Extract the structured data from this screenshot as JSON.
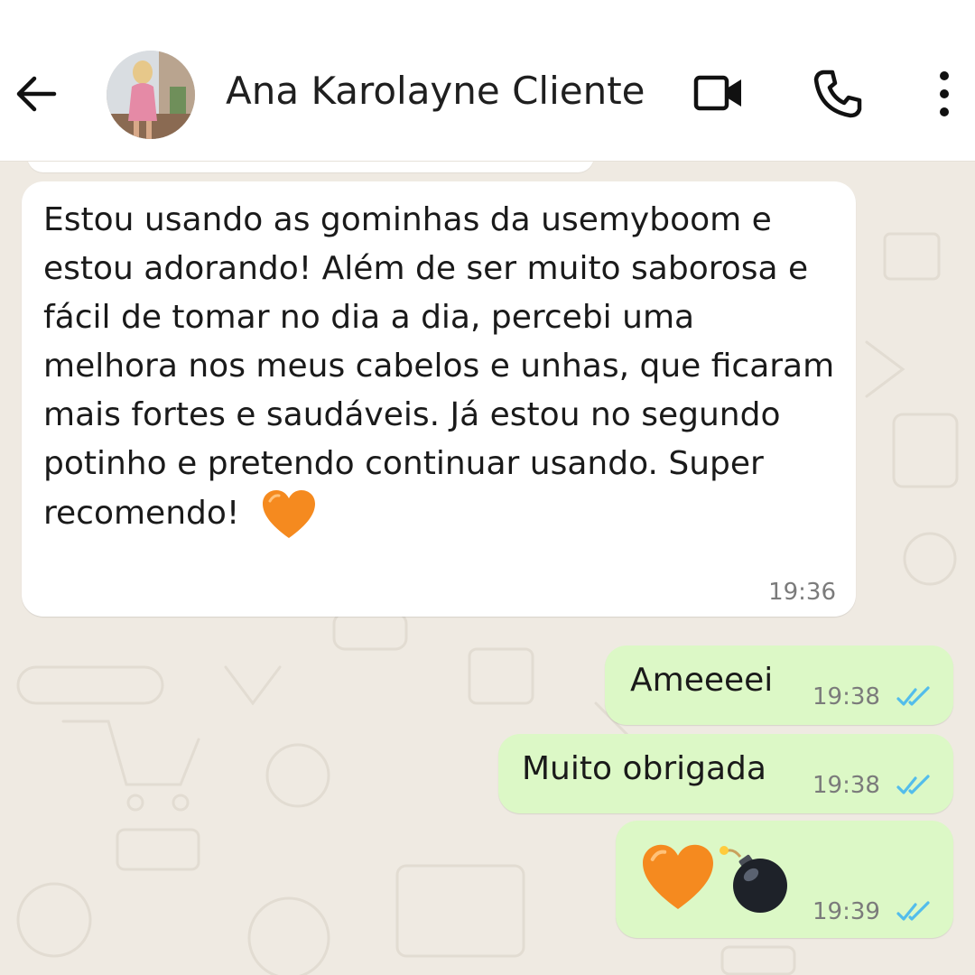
{
  "header": {
    "back_icon": "arrow-left-icon",
    "contact_name": "Ana Karolayne Cliente",
    "icons": [
      "video-call-icon",
      "voice-call-icon",
      "more-options-icon"
    ]
  },
  "messages": [
    {
      "direction": "incoming",
      "text": "Estou usando as gominhas  da usemyboom e estou adorando! Além de ser muito saborosa e fácil de tomar no dia a dia, percebi uma melhora nos meus cabelos e unhas, que ficaram mais fortes e saudáveis. Já estou no segundo potinho e pretendo continuar usando. Super recomendo!",
      "emoji": "orange-heart",
      "time": "19:36"
    },
    {
      "direction": "outgoing",
      "text": "Ameeeei",
      "time": "19:38",
      "status": "read"
    },
    {
      "direction": "outgoing",
      "text": "Muito obrigada",
      "time": "19:38",
      "status": "read"
    },
    {
      "direction": "outgoing",
      "text": "",
      "emoji": [
        "orange-heart",
        "bomb"
      ],
      "time": "19:39",
      "status": "read"
    }
  ],
  "colors": {
    "header_bg": "#ffffff",
    "chat_bg": "#efeae2",
    "incoming_bubble": "#ffffff",
    "outgoing_bubble": "#dcf8c6",
    "read_ticks": "#53bdeb",
    "heart": "#f58a1f"
  }
}
